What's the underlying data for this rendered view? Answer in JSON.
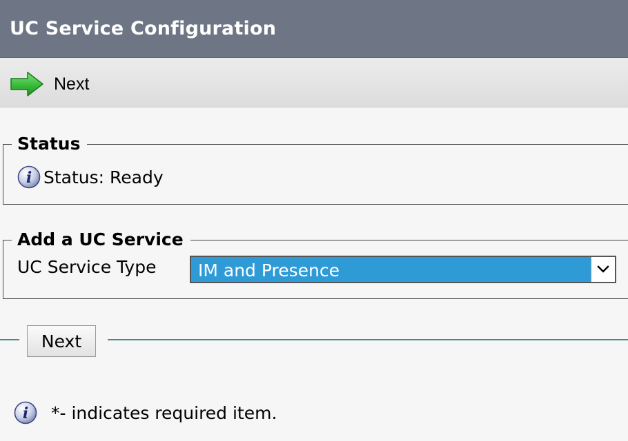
{
  "header": {
    "title": "UC Service Configuration"
  },
  "toolbar": {
    "next_label": "Next",
    "next_icon": "green-arrow-right-icon",
    "arrow_color": "#3fbf3f"
  },
  "status_section": {
    "legend": "Status",
    "icon": "info-icon",
    "text": "Status: Ready"
  },
  "uc_section": {
    "legend": "Add a UC Service",
    "field_label": "UC Service Type",
    "selected_value": "IM and Presence",
    "selected_bg": "#2e9bd7"
  },
  "form": {
    "next_button_label": "Next"
  },
  "footer": {
    "icon": "info-icon",
    "note": "*- indicates required item."
  },
  "colors": {
    "title_bar": "#6e7686",
    "toolbar_bg": "#e4e4e4",
    "page_bg": "#f6f6f6",
    "divider": "#4a8a8a"
  }
}
